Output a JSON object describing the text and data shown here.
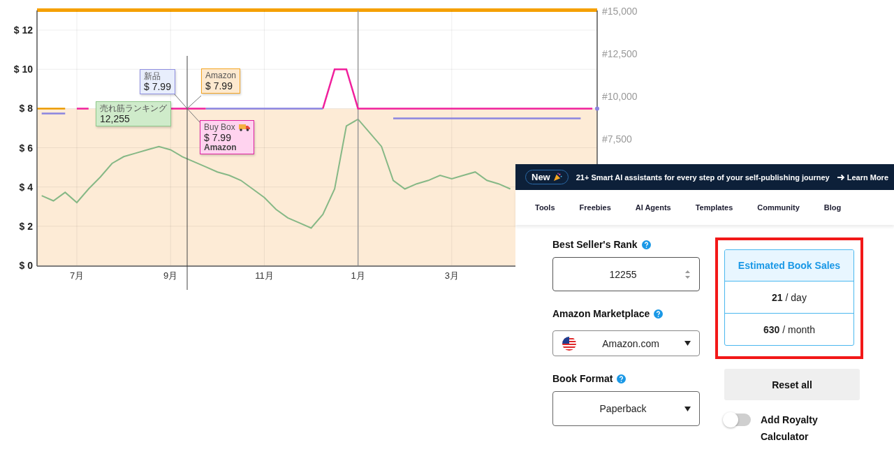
{
  "price_chart": {
    "chart_data": {
      "type": "line",
      "categories": [
        null,
        null,
        null,
        "7月",
        null,
        null,
        null,
        null,
        null,
        null,
        null,
        "9月",
        null,
        null,
        null,
        null,
        null,
        null,
        null,
        "11月",
        null,
        null,
        null,
        null,
        null,
        null,
        null,
        "1月",
        null,
        null,
        null,
        null,
        null,
        null,
        null,
        "3月",
        null,
        null,
        null,
        null,
        null,
        null,
        null,
        null,
        null,
        null,
        null,
        null
      ],
      "ylim": [
        0,
        13
      ],
      "yticks": [
        {
          "value": 0,
          "label": "$ 0"
        },
        {
          "value": 2,
          "label": "$ 2"
        },
        {
          "value": 4,
          "label": "$ 4"
        },
        {
          "value": 6,
          "label": "$ 6"
        },
        {
          "value": 8,
          "label": "$ 8"
        },
        {
          "value": 10,
          "label": "$ 10"
        },
        {
          "value": 12,
          "label": "$ 12"
        }
      ],
      "series": [
        {
          "color": "#8a84e0",
          "values": [
            7.75,
            7.75,
            7.75,
            null,
            null,
            null,
            null,
            null,
            null,
            null,
            null,
            null,
            null,
            null,
            8,
            8,
            8,
            8,
            8,
            8,
            8,
            8,
            8,
            8,
            8,
            null,
            null,
            null,
            null,
            null,
            7.5,
            7.5,
            7.5,
            7.5,
            7.5,
            7.5,
            7.5,
            7.5,
            7.5,
            7.5,
            7.5,
            7.5,
            7.5,
            7.5,
            7.5,
            7.5,
            7.5,
            null
          ]
        },
        {
          "color": "#f0209c",
          "values": [
            null,
            null,
            null,
            8,
            8,
            null,
            null,
            null,
            null,
            null,
            null,
            8,
            8,
            8,
            8,
            null,
            null,
            null,
            null,
            null,
            null,
            null,
            null,
            null,
            8,
            10,
            10,
            8,
            8,
            8,
            8,
            8,
            8,
            8,
            8,
            8,
            8,
            8,
            8,
            8,
            8,
            8,
            8,
            8,
            8,
            8,
            8,
            8
          ]
        }
      ]
    },
    "tooltips": [
      {
        "kind": "new",
        "title": "新品",
        "value": "$ 7.99"
      },
      {
        "kind": "amazon",
        "title": "Amazon",
        "value": "$ 7.99"
      },
      {
        "kind": "rank",
        "title": "売れ筋ランキング",
        "value": "12,255"
      },
      {
        "kind": "buybox",
        "title": "Buy Box",
        "value": "$ 7.99",
        "seller": "Amazon"
      }
    ]
  },
  "rank_chart": {
    "chart_data": {
      "type": "line",
      "ylim": [
        0,
        15000
      ],
      "yticks": [
        {
          "value": 7500,
          "label": "#7,500"
        },
        {
          "value": 10000,
          "label": "#10,000"
        },
        {
          "value": 12500,
          "label": "#12,500"
        },
        {
          "value": 15000,
          "label": "#15,000"
        }
      ],
      "series": [
        {
          "color": "#86b886",
          "values": [
            4100,
            3800,
            4300,
            3700,
            4500,
            5200,
            6000,
            6400,
            6600,
            6800,
            7000,
            6800,
            6400,
            6100,
            5800,
            5500,
            5300,
            5000,
            4500,
            4000,
            3300,
            2800,
            2500,
            2200,
            3000,
            4500,
            8200,
            8600,
            7800,
            7000,
            5000,
            4500,
            4800,
            5000,
            5300,
            5100,
            5300,
            5500,
            5000,
            4800,
            4500,
            null,
            null,
            null,
            null,
            null,
            null,
            null
          ]
        }
      ]
    }
  },
  "banner": {
    "badge": "New",
    "text": "21+ Smart AI assistants for every step of your self-publishing journey",
    "link": "Learn More"
  },
  "nav": [
    "Tools",
    "Freebies",
    "AI Agents",
    "Templates",
    "Community",
    "Blog"
  ],
  "form": {
    "rank": {
      "label": "Best Seller's Rank",
      "value": "12255"
    },
    "marketplace": {
      "label": "Amazon Marketplace",
      "value": "Amazon.com"
    },
    "format": {
      "label": "Book Format",
      "value": "Paperback"
    }
  },
  "results": {
    "title": "Estimated Book Sales",
    "rows": [
      {
        "number": "21",
        "unit": "/ day"
      },
      {
        "number": "630",
        "unit": "/ month"
      }
    ]
  },
  "reset_button": "Reset all",
  "royalty_toggle": {
    "label": "Add Royalty Calculator",
    "on": false
  }
}
